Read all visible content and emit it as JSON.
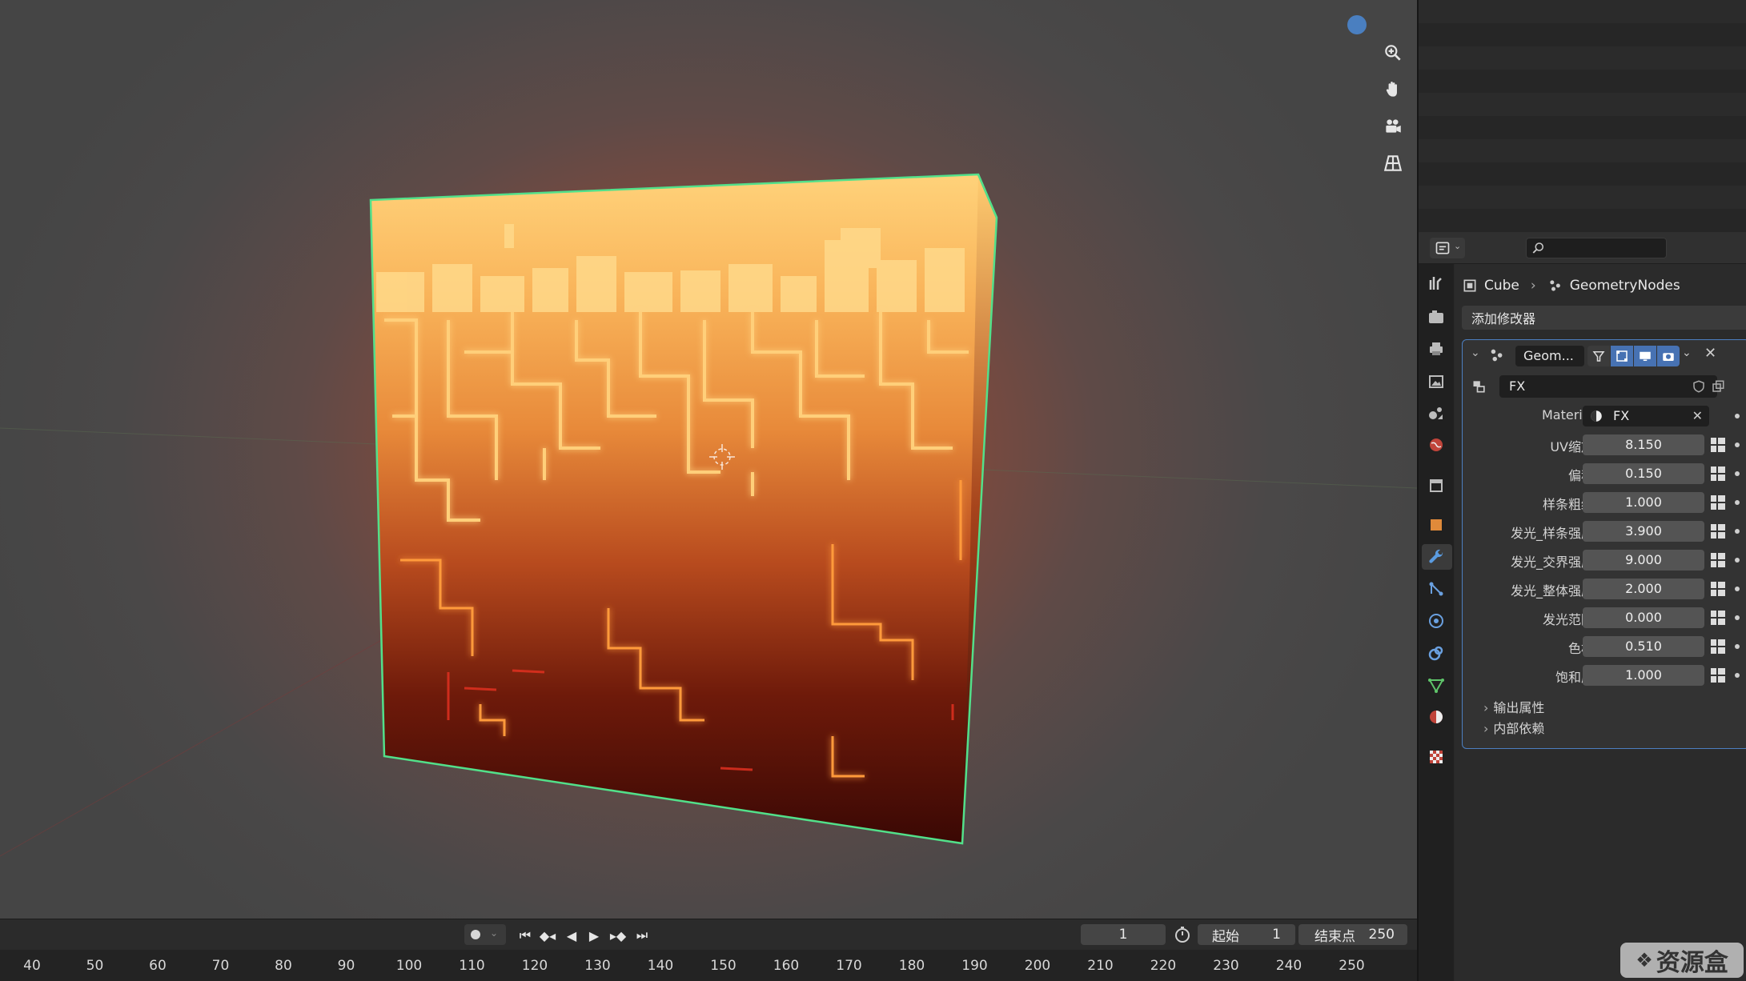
{
  "timeline": {
    "ticks": [
      "40",
      "50",
      "60",
      "70",
      "80",
      "90",
      "100",
      "110",
      "120",
      "130",
      "140",
      "150",
      "160",
      "170",
      "180",
      "190",
      "200",
      "210",
      "220",
      "230",
      "240",
      "250"
    ],
    "current_frame": "1",
    "start_label": "起始",
    "start_value": "1",
    "end_label": "结束点",
    "end_value": "250"
  },
  "properties": {
    "breadcrumb": {
      "object": "Cube",
      "modifier": "GeometryNodes"
    },
    "add_modifier": "添加修改器",
    "modifier": {
      "name": "Geom...",
      "node_group": "FX",
      "params": [
        {
          "label": "Material",
          "value": "FX",
          "kind": "material"
        },
        {
          "label": "UV缩放",
          "value": "8.150"
        },
        {
          "label": "偏移",
          "value": "0.150"
        },
        {
          "label": "样条粗细",
          "value": "1.000"
        },
        {
          "label": "发光_样条强度",
          "value": "3.900"
        },
        {
          "label": "发光_交界强度",
          "value": "9.000"
        },
        {
          "label": "发光_整体强度",
          "value": "2.000"
        },
        {
          "label": "发光范围",
          "value": "0.000"
        },
        {
          "label": "色相",
          "value": "0.510"
        },
        {
          "label": "饱和度",
          "value": "1.000"
        }
      ],
      "subpanels": [
        "输出属性",
        "内部依赖"
      ]
    }
  },
  "watermark": "资源盒",
  "colors": {
    "accent": "#4772b3",
    "selection_outline": "#52e08a",
    "glow": "#ffb347"
  }
}
